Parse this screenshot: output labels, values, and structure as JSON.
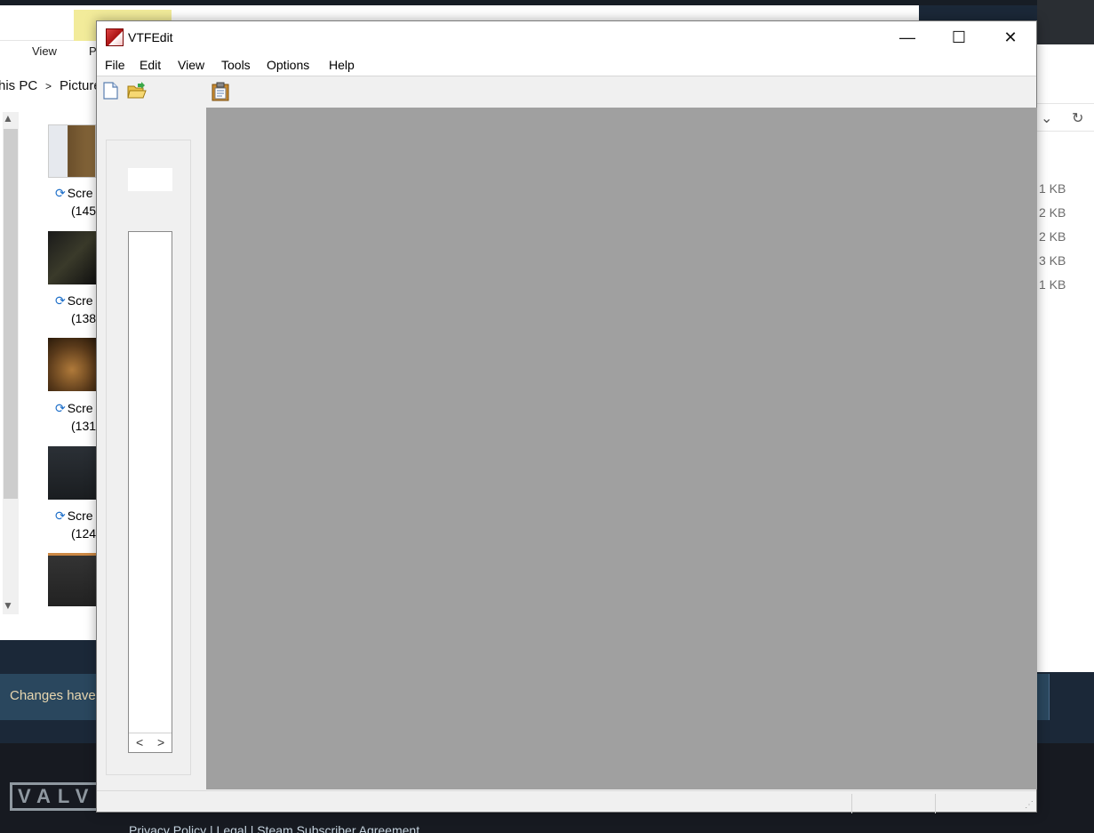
{
  "background": {
    "explorer": {
      "ribbon_tabs": [
        "View",
        "P"
      ],
      "address": [
        "his PC",
        ">",
        "Picture"
      ],
      "files": [
        {
          "label": "Scre",
          "sub": "(145"
        },
        {
          "label": "Scre",
          "sub": "(138"
        },
        {
          "label": "Scre",
          "sub": "(131"
        },
        {
          "label": "Scre",
          "sub": "(124"
        }
      ],
      "sizes": [
        "1 KB",
        "2 KB",
        "2 KB",
        "3 KB",
        "1 KB"
      ],
      "scroll_up": "^",
      "scroll_down": "v"
    },
    "steam": {
      "banner_text": "Changes have",
      "valve_logo": "VALVE",
      "footer_links": "Privacy Policy  |  Legal  |  Steam Subscriber Agreement"
    }
  },
  "window": {
    "title": "VTFEdit",
    "minimize": "—",
    "maximize": "☐",
    "close": "✕"
  },
  "menu": {
    "items": [
      "File",
      "Edit",
      "View",
      "Tools",
      "Options",
      "Help"
    ]
  },
  "toolbar": {
    "buttons": [
      "new-file-icon",
      "open-folder-icon",
      "paste-icon"
    ]
  },
  "left_panel": {
    "nav_prev": "<",
    "nav_next": ">"
  },
  "colors": {
    "viewport": "#a0a0a0",
    "steam_bg": "#1b2838",
    "steam_banner": "#2a475e"
  }
}
